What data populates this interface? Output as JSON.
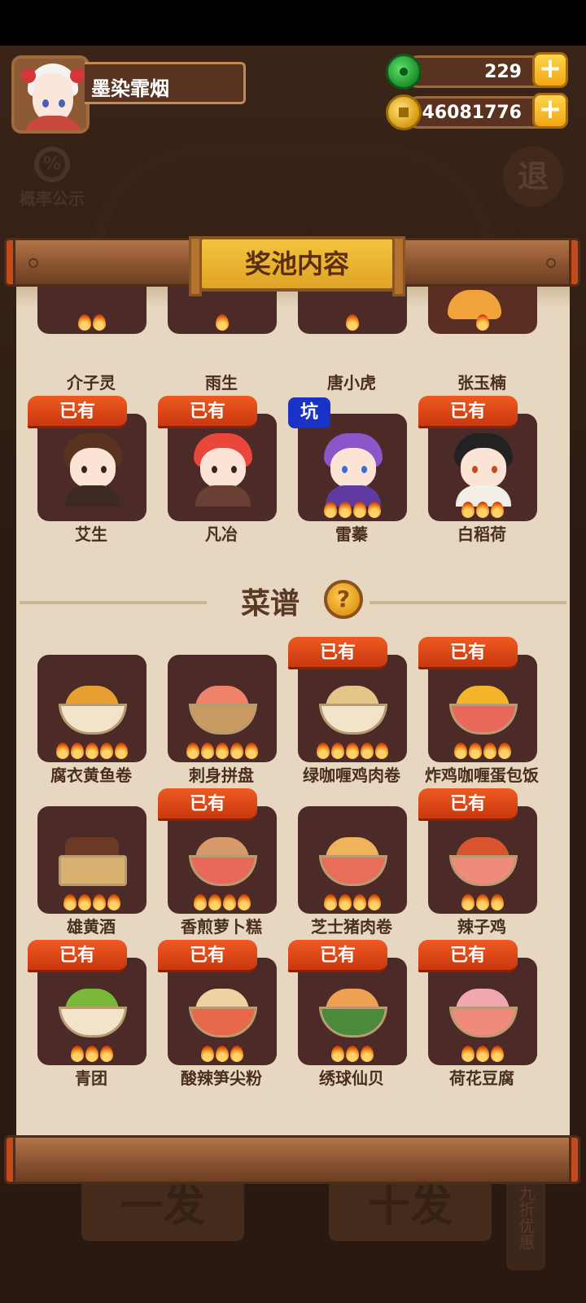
{
  "player": {
    "name": "墨染霏烟"
  },
  "currency": {
    "jade": "229",
    "coins": "46081776"
  },
  "buttons": {
    "probability": "概率公示",
    "probability_symbol": "%",
    "exit": "退",
    "single_draw": "一发",
    "ten_draw": "十发",
    "discount": "九折优惠"
  },
  "panel": {
    "title": "奖池内容"
  },
  "tags": {
    "owned": "已有",
    "pit": "坑"
  },
  "characters_partial": [
    {
      "name": "介子灵",
      "stars": 2
    },
    {
      "name": "雨生",
      "stars": 1
    },
    {
      "name": "唐小虎",
      "stars": 1
    },
    {
      "name": "张玉楠",
      "stars": 1
    }
  ],
  "characters": [
    {
      "name": "艾生",
      "owned": true,
      "stars": 0
    },
    {
      "name": "凡冶",
      "owned": true,
      "stars": 0
    },
    {
      "name": "雷蓁",
      "pit": true,
      "stars": 4
    },
    {
      "name": "白稻荷",
      "owned": true,
      "stars": 3
    }
  ],
  "recipes_section": {
    "title": "菜谱",
    "help": "?"
  },
  "recipes": [
    {
      "name": "腐衣黄鱼卷",
      "owned": false,
      "stars": 5
    },
    {
      "name": "刺身拼盘",
      "owned": false,
      "stars": 5
    },
    {
      "name": "绿咖喱鸡肉卷",
      "owned": true,
      "stars": 5
    },
    {
      "name": "炸鸡咖喱蛋包饭",
      "owned": true,
      "stars": 4
    },
    {
      "name": "雄黄酒",
      "owned": false,
      "stars": 4
    },
    {
      "name": "香煎萝卜糕",
      "owned": true,
      "stars": 4
    },
    {
      "name": "芝士猪肉卷",
      "owned": false,
      "stars": 4
    },
    {
      "name": "辣子鸡",
      "owned": true,
      "stars": 3
    },
    {
      "name": "青团",
      "owned": true,
      "stars": 3
    },
    {
      "name": "酸辣笋尖粉",
      "owned": true,
      "stars": 3
    },
    {
      "name": "绣球仙贝",
      "owned": true,
      "stars": 3
    },
    {
      "name": "荷花豆腐",
      "owned": true,
      "stars": 3
    }
  ]
}
